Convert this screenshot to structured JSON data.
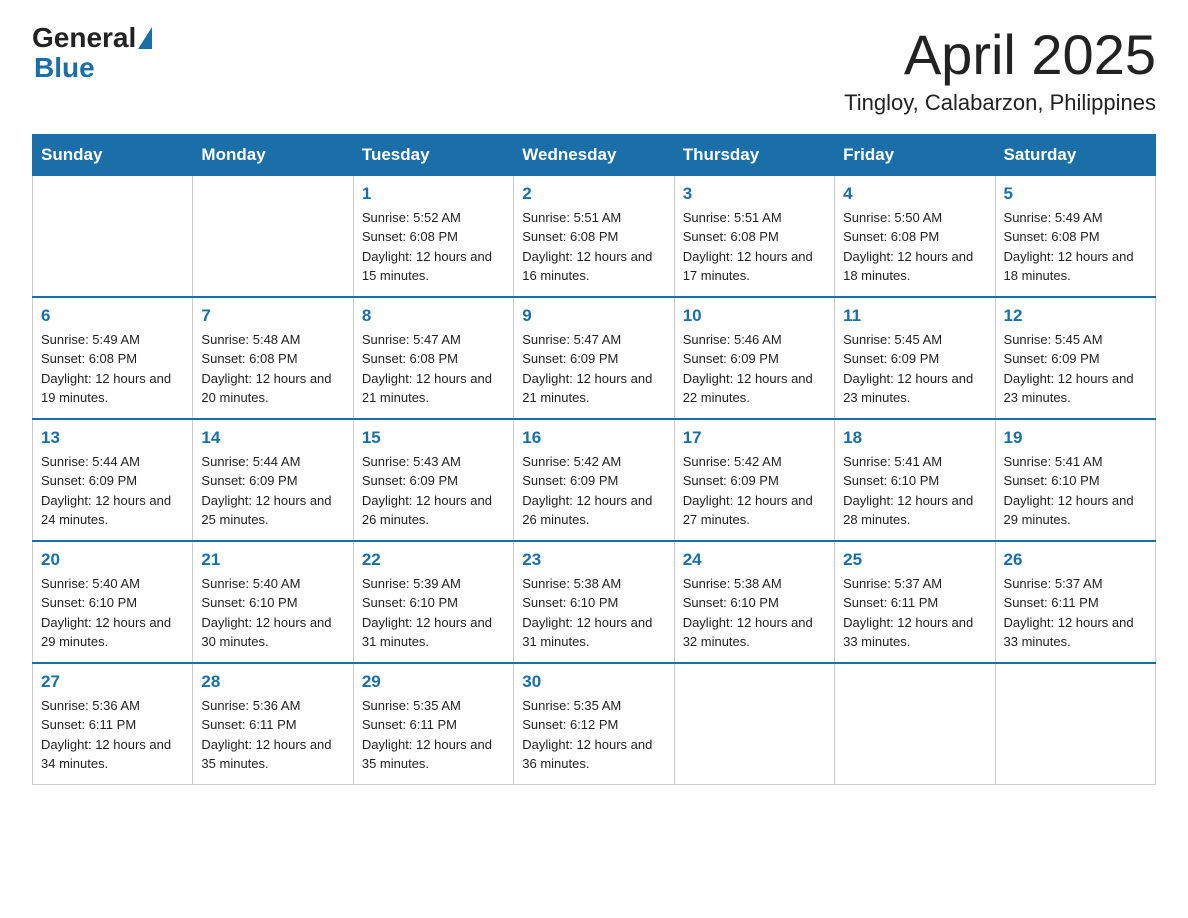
{
  "header": {
    "logo_general": "General",
    "logo_blue": "Blue",
    "month_title": "April 2025",
    "location": "Tingloy, Calabarzon, Philippines"
  },
  "weekdays": [
    "Sunday",
    "Monday",
    "Tuesday",
    "Wednesday",
    "Thursday",
    "Friday",
    "Saturday"
  ],
  "weeks": [
    [
      {
        "day": "",
        "sunrise": "",
        "sunset": "",
        "daylight": ""
      },
      {
        "day": "",
        "sunrise": "",
        "sunset": "",
        "daylight": ""
      },
      {
        "day": "1",
        "sunrise": "Sunrise: 5:52 AM",
        "sunset": "Sunset: 6:08 PM",
        "daylight": "Daylight: 12 hours and 15 minutes."
      },
      {
        "day": "2",
        "sunrise": "Sunrise: 5:51 AM",
        "sunset": "Sunset: 6:08 PM",
        "daylight": "Daylight: 12 hours and 16 minutes."
      },
      {
        "day": "3",
        "sunrise": "Sunrise: 5:51 AM",
        "sunset": "Sunset: 6:08 PM",
        "daylight": "Daylight: 12 hours and 17 minutes."
      },
      {
        "day": "4",
        "sunrise": "Sunrise: 5:50 AM",
        "sunset": "Sunset: 6:08 PM",
        "daylight": "Daylight: 12 hours and 18 minutes."
      },
      {
        "day": "5",
        "sunrise": "Sunrise: 5:49 AM",
        "sunset": "Sunset: 6:08 PM",
        "daylight": "Daylight: 12 hours and 18 minutes."
      }
    ],
    [
      {
        "day": "6",
        "sunrise": "Sunrise: 5:49 AM",
        "sunset": "Sunset: 6:08 PM",
        "daylight": "Daylight: 12 hours and 19 minutes."
      },
      {
        "day": "7",
        "sunrise": "Sunrise: 5:48 AM",
        "sunset": "Sunset: 6:08 PM",
        "daylight": "Daylight: 12 hours and 20 minutes."
      },
      {
        "day": "8",
        "sunrise": "Sunrise: 5:47 AM",
        "sunset": "Sunset: 6:08 PM",
        "daylight": "Daylight: 12 hours and 21 minutes."
      },
      {
        "day": "9",
        "sunrise": "Sunrise: 5:47 AM",
        "sunset": "Sunset: 6:09 PM",
        "daylight": "Daylight: 12 hours and 21 minutes."
      },
      {
        "day": "10",
        "sunrise": "Sunrise: 5:46 AM",
        "sunset": "Sunset: 6:09 PM",
        "daylight": "Daylight: 12 hours and 22 minutes."
      },
      {
        "day": "11",
        "sunrise": "Sunrise: 5:45 AM",
        "sunset": "Sunset: 6:09 PM",
        "daylight": "Daylight: 12 hours and 23 minutes."
      },
      {
        "day": "12",
        "sunrise": "Sunrise: 5:45 AM",
        "sunset": "Sunset: 6:09 PM",
        "daylight": "Daylight: 12 hours and 23 minutes."
      }
    ],
    [
      {
        "day": "13",
        "sunrise": "Sunrise: 5:44 AM",
        "sunset": "Sunset: 6:09 PM",
        "daylight": "Daylight: 12 hours and 24 minutes."
      },
      {
        "day": "14",
        "sunrise": "Sunrise: 5:44 AM",
        "sunset": "Sunset: 6:09 PM",
        "daylight": "Daylight: 12 hours and 25 minutes."
      },
      {
        "day": "15",
        "sunrise": "Sunrise: 5:43 AM",
        "sunset": "Sunset: 6:09 PM",
        "daylight": "Daylight: 12 hours and 26 minutes."
      },
      {
        "day": "16",
        "sunrise": "Sunrise: 5:42 AM",
        "sunset": "Sunset: 6:09 PM",
        "daylight": "Daylight: 12 hours and 26 minutes."
      },
      {
        "day": "17",
        "sunrise": "Sunrise: 5:42 AM",
        "sunset": "Sunset: 6:09 PM",
        "daylight": "Daylight: 12 hours and 27 minutes."
      },
      {
        "day": "18",
        "sunrise": "Sunrise: 5:41 AM",
        "sunset": "Sunset: 6:10 PM",
        "daylight": "Daylight: 12 hours and 28 minutes."
      },
      {
        "day": "19",
        "sunrise": "Sunrise: 5:41 AM",
        "sunset": "Sunset: 6:10 PM",
        "daylight": "Daylight: 12 hours and 29 minutes."
      }
    ],
    [
      {
        "day": "20",
        "sunrise": "Sunrise: 5:40 AM",
        "sunset": "Sunset: 6:10 PM",
        "daylight": "Daylight: 12 hours and 29 minutes."
      },
      {
        "day": "21",
        "sunrise": "Sunrise: 5:40 AM",
        "sunset": "Sunset: 6:10 PM",
        "daylight": "Daylight: 12 hours and 30 minutes."
      },
      {
        "day": "22",
        "sunrise": "Sunrise: 5:39 AM",
        "sunset": "Sunset: 6:10 PM",
        "daylight": "Daylight: 12 hours and 31 minutes."
      },
      {
        "day": "23",
        "sunrise": "Sunrise: 5:38 AM",
        "sunset": "Sunset: 6:10 PM",
        "daylight": "Daylight: 12 hours and 31 minutes."
      },
      {
        "day": "24",
        "sunrise": "Sunrise: 5:38 AM",
        "sunset": "Sunset: 6:10 PM",
        "daylight": "Daylight: 12 hours and 32 minutes."
      },
      {
        "day": "25",
        "sunrise": "Sunrise: 5:37 AM",
        "sunset": "Sunset: 6:11 PM",
        "daylight": "Daylight: 12 hours and 33 minutes."
      },
      {
        "day": "26",
        "sunrise": "Sunrise: 5:37 AM",
        "sunset": "Sunset: 6:11 PM",
        "daylight": "Daylight: 12 hours and 33 minutes."
      }
    ],
    [
      {
        "day": "27",
        "sunrise": "Sunrise: 5:36 AM",
        "sunset": "Sunset: 6:11 PM",
        "daylight": "Daylight: 12 hours and 34 minutes."
      },
      {
        "day": "28",
        "sunrise": "Sunrise: 5:36 AM",
        "sunset": "Sunset: 6:11 PM",
        "daylight": "Daylight: 12 hours and 35 minutes."
      },
      {
        "day": "29",
        "sunrise": "Sunrise: 5:35 AM",
        "sunset": "Sunset: 6:11 PM",
        "daylight": "Daylight: 12 hours and 35 minutes."
      },
      {
        "day": "30",
        "sunrise": "Sunrise: 5:35 AM",
        "sunset": "Sunset: 6:12 PM",
        "daylight": "Daylight: 12 hours and 36 minutes."
      },
      {
        "day": "",
        "sunrise": "",
        "sunset": "",
        "daylight": ""
      },
      {
        "day": "",
        "sunrise": "",
        "sunset": "",
        "daylight": ""
      },
      {
        "day": "",
        "sunrise": "",
        "sunset": "",
        "daylight": ""
      }
    ]
  ]
}
